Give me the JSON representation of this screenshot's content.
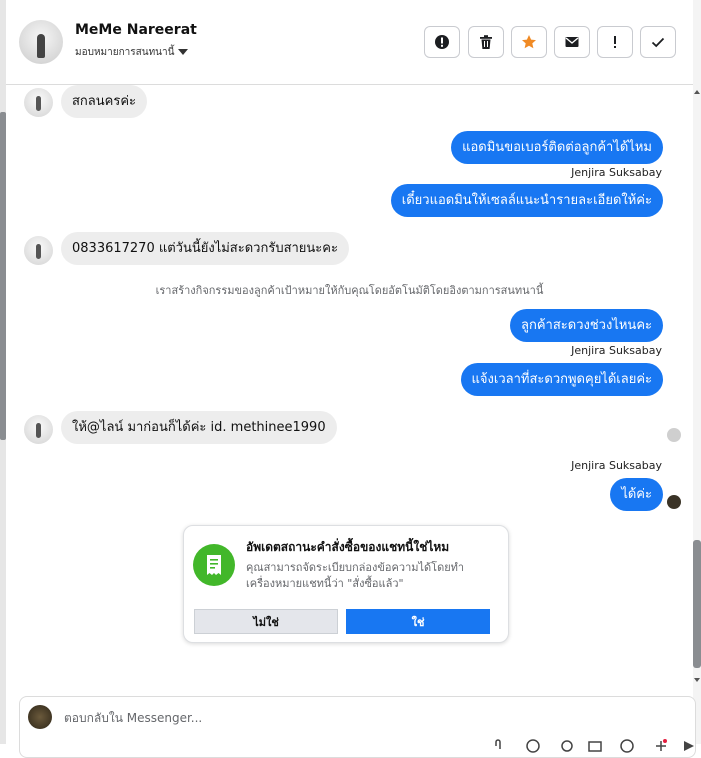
{
  "header": {
    "contact_name": "MeMe Nareerat",
    "assign_label": "มอบหมายการสนทนานี้"
  },
  "toolbar": {
    "icons": [
      "alert-circle-icon",
      "trash-icon",
      "star-icon",
      "envelope-icon",
      "exclamation-icon",
      "check-icon"
    ],
    "star_color": "#f08a24"
  },
  "messages": {
    "m1": "สกลนครค่ะ",
    "m2": "แอดมินขอเบอร์ติดต่อลูกค้าได้ไหม",
    "m2_sender": "Jenjira Suksabay",
    "m3": "เดี๋ยวแอดมินให้เซลล์แนะนำรายละเอียดให้ค่ะ",
    "m4": "0833617270 แต่วันนี้ยังไม่สะดวกรับสายนะคะ",
    "system": "เราสร้างกิจกรรมของลูกค้าเป้าหมายให้กับคุณโดยอัตโนมัติโดยอิงตามการสนทนานี้",
    "m5": "ลูกค้าสะดวงช่วงไหนคะ",
    "m5_sender": "Jenjira Suksabay",
    "m6": "แจ้งเวลาที่สะดวกพูดคุยได้เลยค่ะ",
    "m7": "ให้@ไลน์ มาก่อนก็ได้ค่ะ id. methinee1990",
    "m8_sender": "Jenjira Suksabay",
    "m8": "ได้ค่ะ"
  },
  "card": {
    "title": "อัพเดตสถานะคำสั่งซื้อของแชทนี้ใช่ไหม",
    "body": "คุณสามารถจัดระเบียบกล่องข้อความได้โดยทำเครื่องหมายแชทนี้ว่า \"สั่งซื้อแล้ว\"",
    "no_label": "ไม่ใช่",
    "yes_label": "ใช่"
  },
  "composer": {
    "placeholder": "ตอบกลับใน Messenger..."
  },
  "colors": {
    "accent": "#1877f2",
    "incoming_bubble": "#ededed",
    "card_icon": "#42b72a"
  }
}
